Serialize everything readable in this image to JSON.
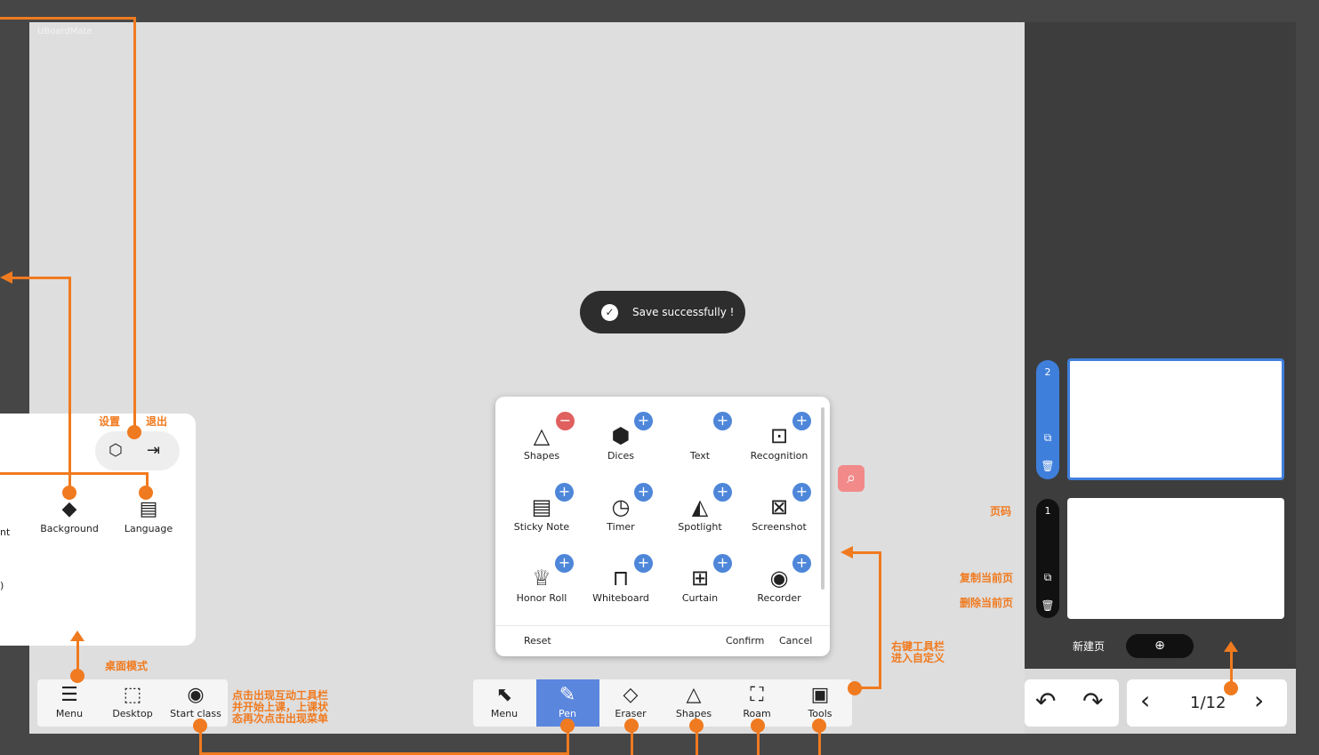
{
  "app": {
    "brand": "UBoardMate"
  },
  "toast": {
    "message": "Save successfully !"
  },
  "menu_panel": {
    "items": [
      {
        "label": "Background",
        "icon": "paint-bucket-icon"
      },
      {
        "label": "Language",
        "icon": "translate-icon"
      }
    ],
    "partial_label": "nt",
    "partial_glyph": ")"
  },
  "left_toolbar": {
    "items": [
      {
        "label": "Menu",
        "icon": "hamburger-icon"
      },
      {
        "label": "Desktop",
        "icon": "desktop-icon"
      },
      {
        "label": "Start class",
        "icon": "broadcast-icon"
      }
    ]
  },
  "main_toolbar": {
    "items": [
      {
        "label": "Menu",
        "icon": "cursor-icon"
      },
      {
        "label": "Pen",
        "icon": "pen-icon",
        "active": true
      },
      {
        "label": "Eraser",
        "icon": "eraser-icon"
      },
      {
        "label": "Shapes",
        "icon": "triangle-icon"
      },
      {
        "label": "Roam",
        "icon": "roam-icon"
      },
      {
        "label": "Tools",
        "icon": "toolbox-icon"
      }
    ]
  },
  "customize": {
    "items": [
      {
        "label": "Shapes",
        "icon": "triangle-icon",
        "badge": "minus"
      },
      {
        "label": "Dices",
        "icon": "dice-icon",
        "badge": "plus"
      },
      {
        "label": "Text",
        "icon": "",
        "badge": "plus"
      },
      {
        "label": "Recognition",
        "icon": "recognition-icon",
        "badge": "plus"
      },
      {
        "label": "Sticky Note",
        "icon": "sticky-note-icon",
        "badge": "plus"
      },
      {
        "label": "Timer",
        "icon": "timer-icon",
        "badge": "plus"
      },
      {
        "label": "Spotlight",
        "icon": "spotlight-icon",
        "badge": "plus"
      },
      {
        "label": "Screenshot",
        "icon": "crop-icon",
        "badge": "plus"
      },
      {
        "label": "Honor Roll",
        "icon": "trophy-icon",
        "badge": "plus"
      },
      {
        "label": "Whiteboard",
        "icon": "whiteboard-icon",
        "badge": "plus"
      },
      {
        "label": "Curtain",
        "icon": "curtain-icon",
        "badge": "plus"
      },
      {
        "label": "Recorder",
        "icon": "record-icon",
        "badge": "plus"
      }
    ],
    "reset": "Reset",
    "confirm": "Confirm",
    "cancel": "Cancel"
  },
  "pages": {
    "tabs": [
      {
        "number": "2",
        "selected": true
      },
      {
        "number": "1",
        "selected": false
      }
    ],
    "indicator": "1/12"
  },
  "annotations": {
    "settings": "设置",
    "exit": "退出",
    "desktop_mode": "桌面模式",
    "start_class_note": [
      "点击出现互动工具栏",
      "并开始上课，上课状",
      "态再次点击出现菜单"
    ],
    "right_click_note": [
      "右键工具栏",
      "进入自定义"
    ],
    "page_number": "页码",
    "copy_page": "复制当前页",
    "delete_page": "删除当前页",
    "new_page": "新建页"
  },
  "colors": {
    "accent": "#f07a1f",
    "active": "#5b86de",
    "plus": "#4e86d9",
    "minus": "#e05f5f"
  }
}
